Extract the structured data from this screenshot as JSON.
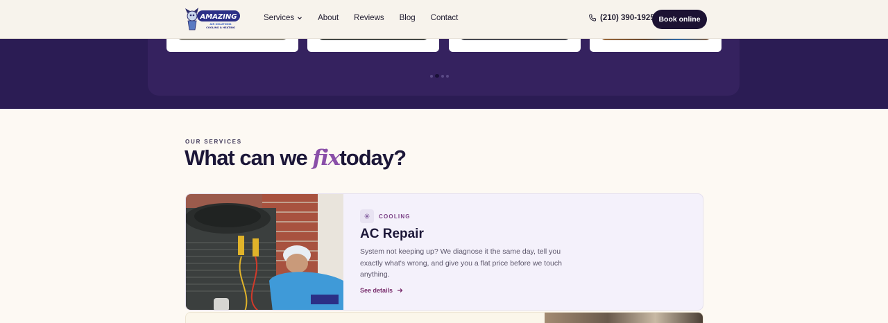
{
  "brand": {
    "name": "AMAZING",
    "sub1": "AIR SOLUTIONS",
    "sub2": "COOLING & HEATING"
  },
  "nav": {
    "items": [
      {
        "label": "Services",
        "has_dropdown": true
      },
      {
        "label": "About"
      },
      {
        "label": "Reviews"
      },
      {
        "label": "Blog"
      },
      {
        "label": "Contact"
      }
    ]
  },
  "header": {
    "phone": "(210) 390-1925",
    "book_label": "Book online"
  },
  "carousel": {
    "slide_count": 4,
    "dot_count": 4,
    "active_dot": 1
  },
  "services_section": {
    "eyebrow": "OUR SERVICES",
    "headline_pre": "What can we",
    "headline_accent": "fix",
    "headline_post": "today?",
    "accent_color": "#8a4fa8"
  },
  "service": {
    "category": "COOLING",
    "title": "AC Repair",
    "description": "System not keeping up? We diagnose it the same day, tell you exactly what's wrong, and give you a flat price before we touch anything.",
    "link_label": "See details",
    "link_icon": "arrow-right-icon",
    "category_icon": "snowflake-icon"
  },
  "colors": {
    "band": "#2b1c54",
    "button": "#1c1233",
    "link": "#7a2f6e"
  }
}
